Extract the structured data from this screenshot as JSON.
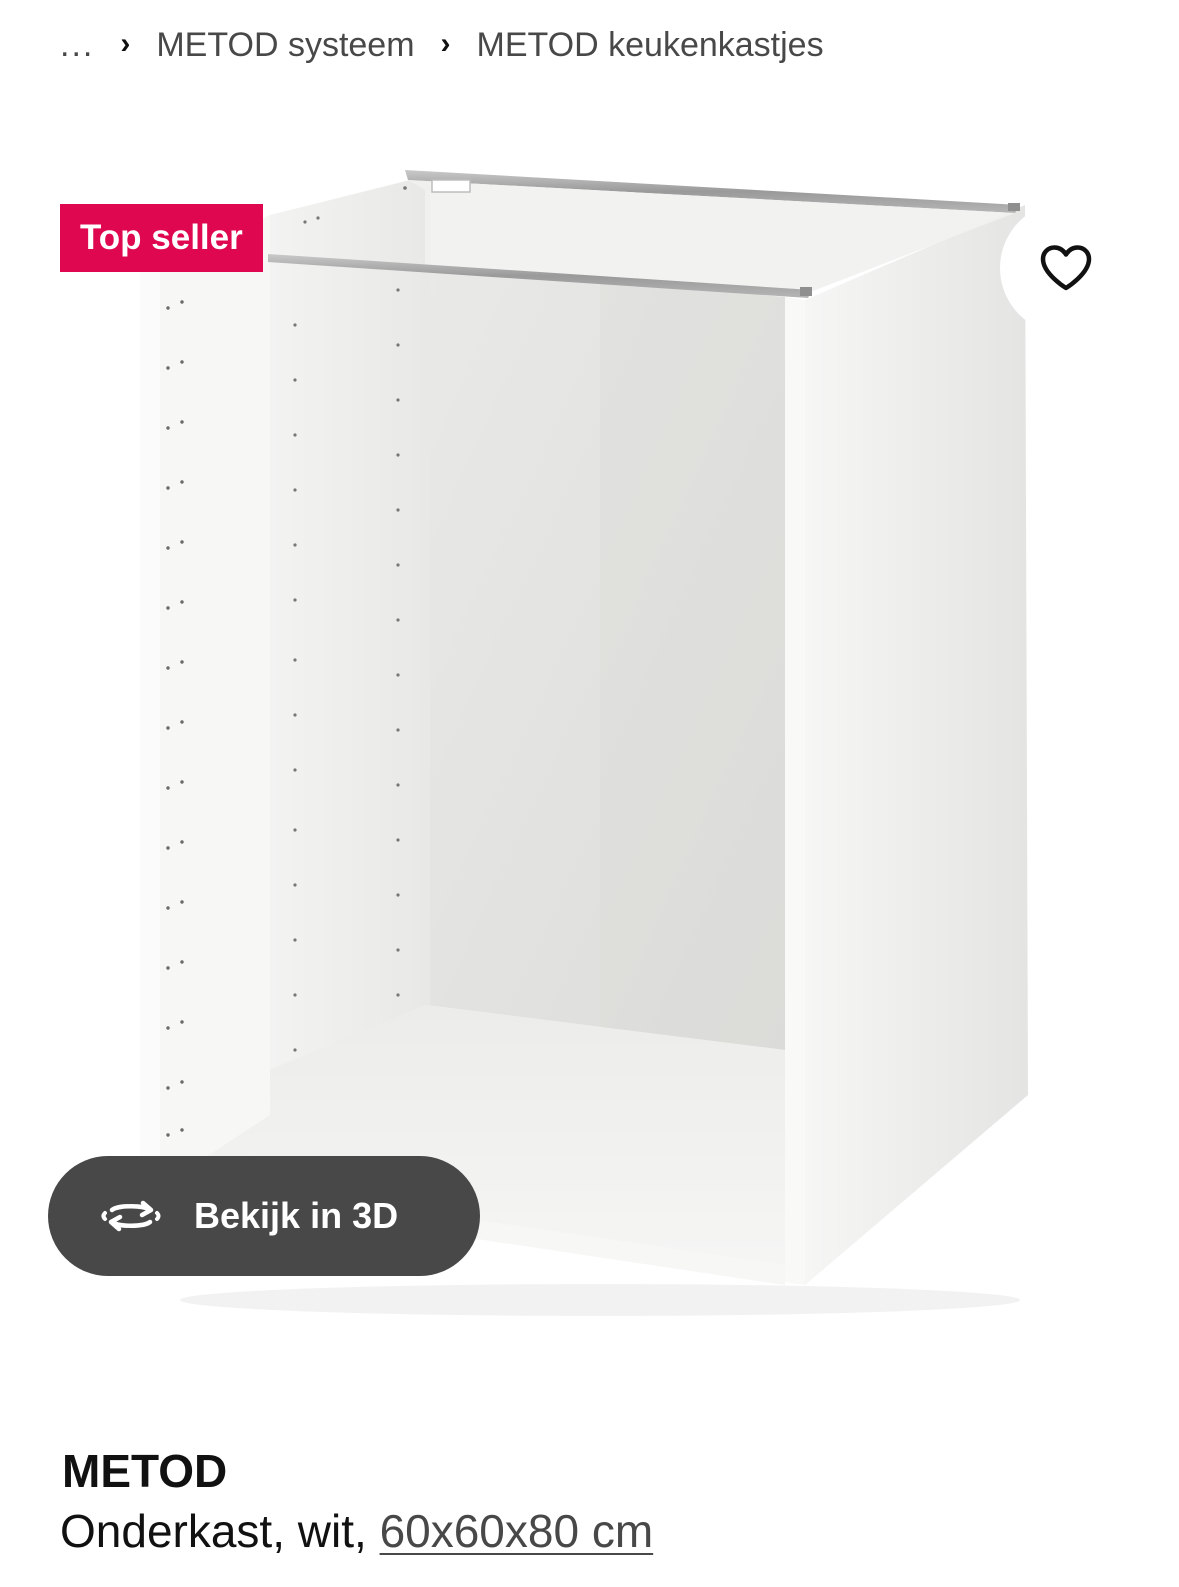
{
  "breadcrumb": {
    "ellipsis": "...",
    "items": [
      "METOD systeem",
      "METOD keukenkastjes"
    ],
    "separator": "›"
  },
  "badge": {
    "label": "Top seller",
    "color": "#e00751"
  },
  "favourite": {
    "icon": "heart-outline-icon"
  },
  "view3d": {
    "label": "Bekijk in 3D",
    "icon": "rotate-3d-icon"
  },
  "product": {
    "name": "METOD",
    "description_prefix": "Onderkast, wit, ",
    "dimensions": "60x60x80 cm"
  }
}
